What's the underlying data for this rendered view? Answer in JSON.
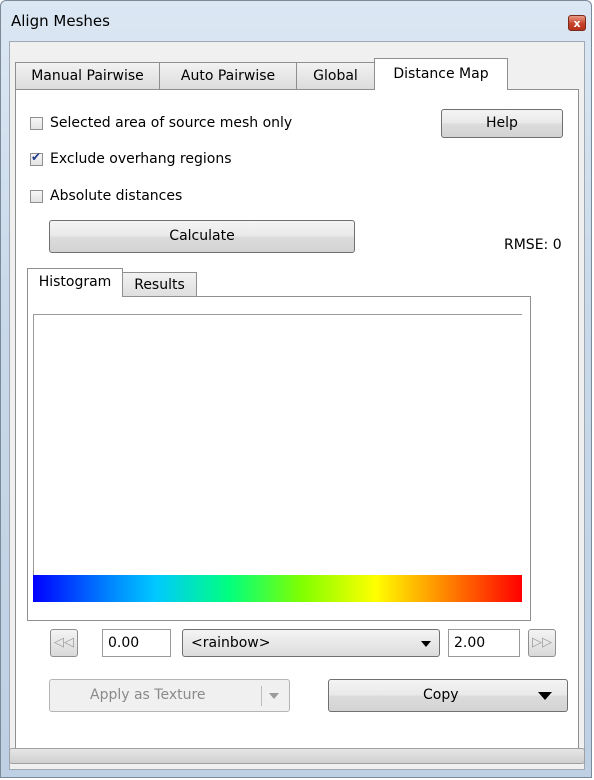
{
  "window": {
    "title": "Align Meshes",
    "close_glyph": "x"
  },
  "tabs": [
    {
      "label": "Manual Pairwise",
      "active": false
    },
    {
      "label": "Auto Pairwise",
      "active": false
    },
    {
      "label": "Global",
      "active": false
    },
    {
      "label": "Distance Map",
      "active": true
    }
  ],
  "options": {
    "selected_area": {
      "label": "Selected area of source mesh only",
      "checked": false
    },
    "exclude_overhang": {
      "label": "Exclude overhang regions",
      "checked": true
    },
    "absolute_distances": {
      "label": "Absolute distances",
      "checked": false
    }
  },
  "buttons": {
    "help": "Help",
    "calculate": "Calculate",
    "apply_texture": "Apply as Texture",
    "copy": "Copy"
  },
  "rmse": "RMSE: 0",
  "inner_tabs": [
    {
      "label": "Histogram",
      "active": true
    },
    {
      "label": "Results",
      "active": false
    }
  ],
  "colormap": {
    "min_value": "0.00",
    "max_value": "2.00",
    "selected": "<rainbow>"
  },
  "icons": {
    "prev": "rewind-icon",
    "next": "fast-forward-icon",
    "dropdown": "chevron-down-icon"
  }
}
